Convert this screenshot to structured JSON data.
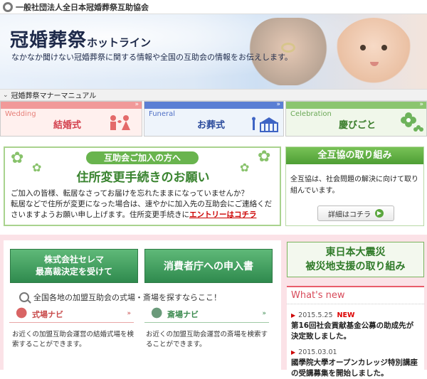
{
  "header": {
    "org_name": "一般社団法人全日本冠婚葬祭互助協会"
  },
  "hero": {
    "title_main": "冠婚葬祭",
    "title_small": "ホットライン",
    "subtitle": "なかなか聞けない冠婚葬祭に関する情報や全国の互助会の情報をお伝えします。"
  },
  "manner": {
    "label": "冠婚葬祭マナーマニュアル"
  },
  "categories": [
    {
      "en": "Wedding",
      "ja": "結婚式"
    },
    {
      "en": "Funeral",
      "ja": "お葬式"
    },
    {
      "en": "Celebration",
      "ja": "慶びごと"
    }
  ],
  "notice": {
    "pill": "互助会ご加入の方へ",
    "headline": "住所変更手続きのお願い",
    "line1": "ご加入の皆様、転居なさってお届けを忘れたままになっていませんか？",
    "line2": "転居などで住所が変更になった場合は、速やかに加入先の互助会にご連絡くださいますようお願い申し上げます。住所変更手続きに",
    "link": "エントリーはコチラ"
  },
  "zengokyo": {
    "head": "全互協の取り組み",
    "body": "全互協は、社会問題の解決に向けて取り組んでいます。",
    "button": "詳細はコチラ"
  },
  "left_buttons": {
    "btn1_line1": "株式会社セレマ",
    "btn1_line2": "最高裁決定を受けて",
    "btn2": "消費者庁への申入書"
  },
  "search": {
    "text": "全国各地の加盟互助会の式場・斎場を探すならここ！"
  },
  "navis": [
    {
      "label": "式場ナビ",
      "desc": "お近くの加盟互助会運営の結婚式場を検索することができます。"
    },
    {
      "label": "斎場ナビ",
      "desc": "お近くの加盟互助会運営の斎場を検索することができます。"
    }
  ],
  "quake": {
    "line1": "東日本大震災",
    "line2": "被災地支援の取り組み"
  },
  "whatsnew": {
    "heading": "What's new",
    "items": [
      {
        "date": "2015.5.25",
        "badge": "NEW",
        "title": "第16回社会貢献基金公募の助成先が決定致しました。"
      },
      {
        "date": "2015.03.01",
        "badge": "",
        "title": "國學院大學オープンカレッジ特別講座の受講募集を開始しました。"
      }
    ]
  }
}
